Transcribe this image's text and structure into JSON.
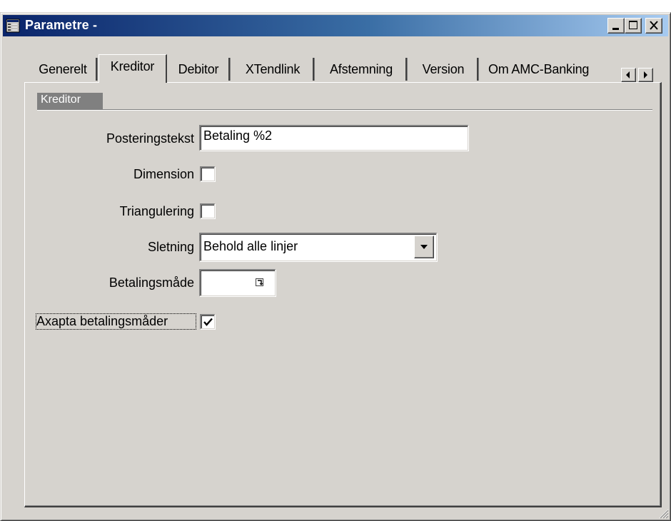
{
  "window": {
    "title": "Parametre -",
    "minimize_icon": "minimize-icon",
    "maximize_icon": "maximize-icon",
    "close_icon": "close-icon"
  },
  "tabs": [
    {
      "label": "Generelt",
      "active": false
    },
    {
      "label": "Kreditor",
      "active": true
    },
    {
      "label": "Debitor",
      "active": false
    },
    {
      "label": "XTendlink",
      "active": false
    },
    {
      "label": "Afstemning",
      "active": false
    },
    {
      "label": "Version",
      "active": false
    },
    {
      "label": "Om AMC-Banking",
      "active": false
    }
  ],
  "group": {
    "label": "Kreditor"
  },
  "fields": {
    "posteringstekst": {
      "label": "Posteringstekst",
      "value": "Betaling %2"
    },
    "dimension": {
      "label": "Dimension",
      "checked": false
    },
    "triangulering": {
      "label": "Triangulering",
      "checked": false
    },
    "sletning": {
      "label": "Sletning",
      "value": "Behold alle linjer"
    },
    "betalingsmaade": {
      "label": "Betalingsmåde",
      "value": ""
    },
    "axapta": {
      "label": "Axapta betalingsmåder",
      "checked": true
    }
  },
  "colors": {
    "title_start": "#0a246a",
    "title_end": "#a6caf0",
    "face": "#d6d3ce",
    "group_header": "#808080"
  }
}
